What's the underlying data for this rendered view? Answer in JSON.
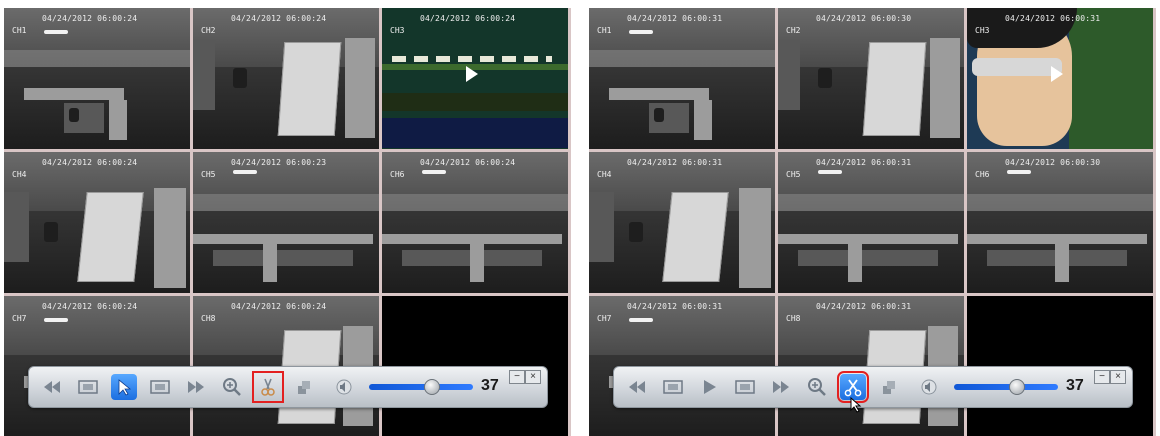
{
  "panels": [
    {
      "id": "left",
      "cameras": [
        {
          "timestamp": "04/24/2012 06:00:24",
          "channel": "CH1",
          "selected": true,
          "scene": "office"
        },
        {
          "timestamp": "04/24/2012 06:00:24",
          "channel": "CH2",
          "selected": false,
          "scene": "office"
        },
        {
          "timestamp": "04/24/2012 06:00:24",
          "channel": "CH3",
          "selected": false,
          "scene": "cartoon-field"
        },
        {
          "timestamp": "04/24/2012 06:00:24",
          "channel": "CH4",
          "selected": false,
          "scene": "office"
        },
        {
          "timestamp": "04/24/2012 06:00:23",
          "channel": "CH5",
          "selected": false,
          "scene": "office"
        },
        {
          "timestamp": "04/24/2012 06:00:24",
          "channel": "CH6",
          "selected": false,
          "scene": "office"
        },
        {
          "timestamp": "04/24/2012 06:00:24",
          "channel": "CH7",
          "selected": false,
          "scene": "office"
        },
        {
          "timestamp": "04/24/2012 06:00:24",
          "channel": "CH8",
          "selected": false,
          "scene": "office"
        }
      ],
      "toolbar": {
        "active_tool": "select-pointer",
        "highlighted_tool": "scissors",
        "volume_value": "37",
        "volume_fraction": 0.6
      }
    },
    {
      "id": "right",
      "cameras": [
        {
          "timestamp": "04/24/2012 06:00:31",
          "channel": "CH1",
          "selected": true,
          "scene": "office"
        },
        {
          "timestamp": "04/24/2012 06:00:30",
          "channel": "CH2",
          "selected": false,
          "scene": "office"
        },
        {
          "timestamp": "04/24/2012 06:00:31",
          "channel": "CH3",
          "selected": false,
          "scene": "cartoon-face"
        },
        {
          "timestamp": "04/24/2012 06:00:31",
          "channel": "CH4",
          "selected": false,
          "scene": "office"
        },
        {
          "timestamp": "04/24/2012 06:00:31",
          "channel": "CH5",
          "selected": false,
          "scene": "office"
        },
        {
          "timestamp": "04/24/2012 06:00:30",
          "channel": "CH6",
          "selected": false,
          "scene": "office"
        },
        {
          "timestamp": "04/24/2012 06:00:31",
          "channel": "CH7",
          "selected": false,
          "scene": "office"
        },
        {
          "timestamp": "04/24/2012 06:00:31",
          "channel": "CH8",
          "selected": false,
          "scene": "office"
        }
      ],
      "toolbar": {
        "active_tool": "scissors",
        "highlighted_tool": "scissors",
        "volume_value": "37",
        "volume_fraction": 0.6
      }
    }
  ],
  "toolbar_icons": [
    "rewind-icon",
    "film-step-back-icon",
    "play-select-icon",
    "film-step-forward-icon",
    "fast-forward-icon",
    "zoom-in-icon",
    "scissors-icon",
    "stack-icon",
    "speaker-icon"
  ],
  "colors": {
    "selection_border": "#55c23f",
    "highlight_box": "#e32020",
    "active_button": "#1c6ee0",
    "volume_track": "#0f57d6"
  }
}
